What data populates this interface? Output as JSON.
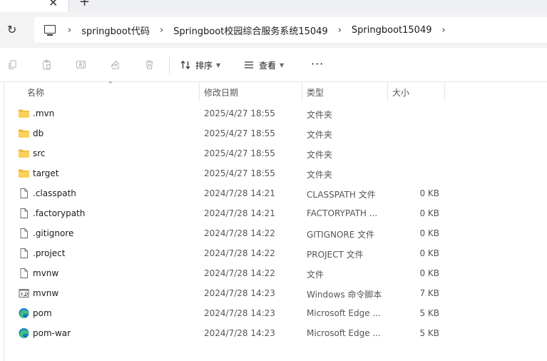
{
  "tabstrip": {
    "close_glyph": "✕",
    "new_tab_glyph": "+"
  },
  "address": {
    "refresh_glyph": "↻",
    "breadcrumb": [
      "springboot代码",
      "Springboot校园综合服务系统15049",
      "Springboot15049"
    ],
    "separator": "›"
  },
  "toolbar": {
    "icons": [
      "copy-icon",
      "paste-icon",
      "rename-icon",
      "share-icon",
      "delete-icon"
    ],
    "sort_label": "排序",
    "view_label": "查看",
    "more_label": "···"
  },
  "columns": {
    "name": "名称",
    "date": "修改日期",
    "type": "类型",
    "size": "大小"
  },
  "files": [
    {
      "name": ".mvn",
      "date": "2025/4/27 18:55",
      "type": "文件夹",
      "size": "",
      "icon": "folder-icon"
    },
    {
      "name": "db",
      "date": "2025/4/27 18:55",
      "type": "文件夹",
      "size": "",
      "icon": "folder-icon"
    },
    {
      "name": "src",
      "date": "2025/4/27 18:55",
      "type": "文件夹",
      "size": "",
      "icon": "folder-icon"
    },
    {
      "name": "target",
      "date": "2025/4/27 18:55",
      "type": "文件夹",
      "size": "",
      "icon": "folder-icon"
    },
    {
      "name": ".classpath",
      "date": "2024/7/28 14:21",
      "type": "CLASSPATH 文件",
      "size": "0 KB",
      "icon": "file-icon"
    },
    {
      "name": ".factorypath",
      "date": "2024/7/28 14:21",
      "type": "FACTORYPATH ...",
      "size": "0 KB",
      "icon": "file-icon"
    },
    {
      "name": ".gitignore",
      "date": "2024/7/28 14:22",
      "type": "GITIGNORE 文件",
      "size": "0 KB",
      "icon": "file-icon"
    },
    {
      "name": ".project",
      "date": "2024/7/28 14:22",
      "type": "PROJECT 文件",
      "size": "0 KB",
      "icon": "file-icon"
    },
    {
      "name": "mvnw",
      "date": "2024/7/28 14:22",
      "type": "文件",
      "size": "0 KB",
      "icon": "file-icon"
    },
    {
      "name": "mvnw",
      "date": "2024/7/28 14:23",
      "type": "Windows 命令脚本",
      "size": "7 KB",
      "icon": "script-icon"
    },
    {
      "name": "pom",
      "date": "2024/7/28 14:23",
      "type": "Microsoft Edge ...",
      "size": "5 KB",
      "icon": "edge-icon"
    },
    {
      "name": "pom-war",
      "date": "2024/7/28 14:23",
      "type": "Microsoft Edge ...",
      "size": "5 KB",
      "icon": "edge-icon"
    }
  ],
  "colors": {
    "folder": "#f8c73a",
    "edge_blue": "#1b7fd0",
    "edge_green": "#45c07a"
  }
}
